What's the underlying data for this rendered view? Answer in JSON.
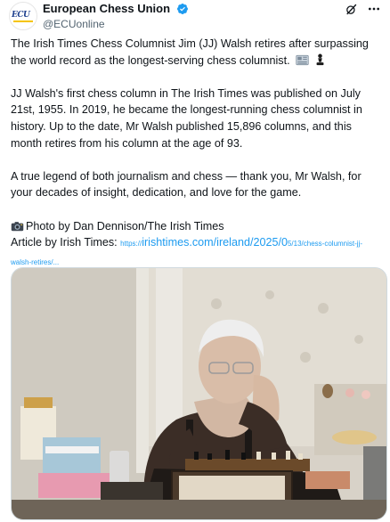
{
  "header": {
    "display_name": "European Chess Union",
    "handle": "@ECUonline",
    "avatar_text": "ECU"
  },
  "tweet": {
    "p1": "The Irish Times Chess Columnist Jim (JJ) Walsh retires after surpassing the world record as the longest-serving chess columnist.",
    "p2": "JJ Walsh's first chess column in The Irish Times was published on July 21st, 1955. In 2019, he became the longest-running chess columnist in history. Up to the date, Mr Walsh published 15,896 columns, and this month retires from his column at the age of 93.",
    "p3": "A true legend of both journalism and chess — thank you, Mr Walsh, for your decades of insight, dedication, and love for the game.",
    "photo_credit": "Photo by Dan Dennison/The Irish Times",
    "article_label": "Article by Irish Times:",
    "link_prefix": "https://",
    "link_main": "irishtimes.com/ireland/2025/0",
    "link_suffix": "5/13/chess-columnist-jj-walsh-retires/..."
  },
  "colors": {
    "verified": "#1d9bf0",
    "link": "#1d9bf0"
  },
  "icons": [
    "verified-badge-icon",
    "grok-icon",
    "more-icon",
    "newspaper-icon",
    "chess-pawn-icon",
    "camera-icon"
  ]
}
